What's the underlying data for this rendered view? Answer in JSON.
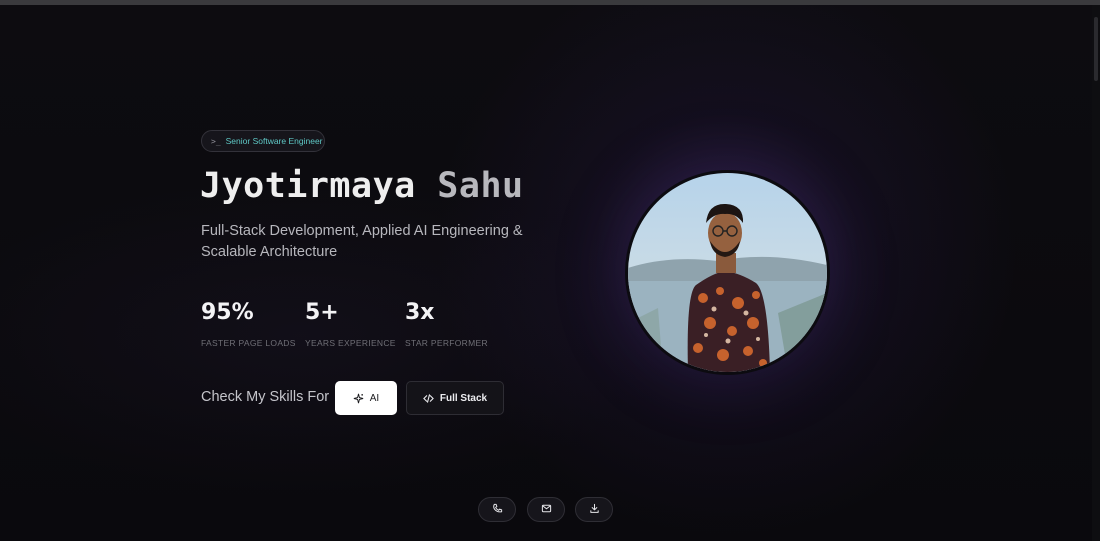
{
  "hero": {
    "badge": "Senior Software Engineer",
    "name_first": "Jyotirmaya",
    "name_last": "Sahu",
    "subtitle": "Full-Stack Development, Applied AI Engineering & Scalable Architecture"
  },
  "stats": [
    {
      "value": "95%",
      "label": "FASTER PAGE LOADS"
    },
    {
      "value": "5+",
      "label": "YEARS EXPERIENCE"
    },
    {
      "value": "3x",
      "label": "STAR PERFORMER"
    }
  ],
  "skills": {
    "label": "Check My Skills For",
    "ai_button": "AI",
    "fullstack_button": "Full Stack"
  },
  "footer_actions": [
    {
      "icon": "phone-icon"
    },
    {
      "icon": "mail-icon"
    },
    {
      "icon": "download-icon"
    }
  ],
  "colors": {
    "background": "#0b0a0e",
    "accent_badge_text": "#5fc9c6",
    "glow": "#5c3896"
  }
}
